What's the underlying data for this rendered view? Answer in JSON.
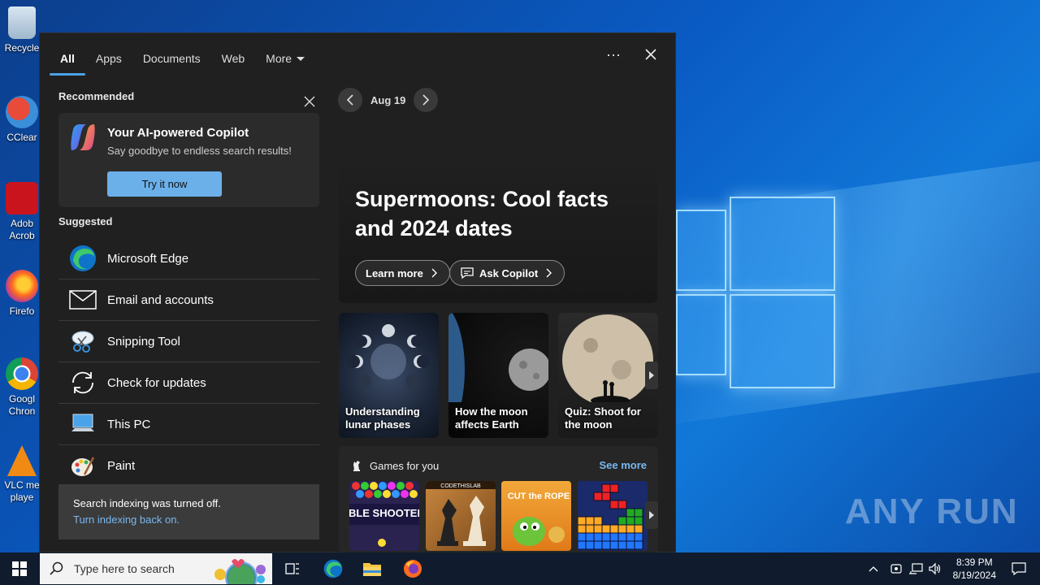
{
  "desktop": {
    "icons": [
      {
        "label": "Recycle"
      },
      {
        "label": "CClear"
      },
      {
        "label": "Adob Acrob"
      },
      {
        "label": "Firefo"
      },
      {
        "label": "Googl Chron"
      },
      {
        "label": "VLC me playe"
      }
    ],
    "watermark": "ANY RUN"
  },
  "search_panel": {
    "tabs": [
      {
        "label": "All"
      },
      {
        "label": "Apps"
      },
      {
        "label": "Documents"
      },
      {
        "label": "Web"
      },
      {
        "label": "More"
      }
    ],
    "recommended": {
      "heading": "Recommended",
      "card_title": "Your AI-powered Copilot",
      "card_subtitle": "Say goodbye to endless search results!",
      "card_button": "Try it now"
    },
    "suggested": {
      "heading": "Suggested",
      "items": [
        {
          "label": "Microsoft Edge",
          "icon": "edge-icon"
        },
        {
          "label": "Email and accounts",
          "icon": "mail-icon"
        },
        {
          "label": "Snipping Tool",
          "icon": "snipping-tool-icon"
        },
        {
          "label": "Check for updates",
          "icon": "sync-icon"
        },
        {
          "label": "This PC",
          "icon": "computer-icon"
        },
        {
          "label": "Paint",
          "icon": "paint-icon"
        }
      ]
    },
    "indexing": {
      "message": "Search indexing was turned off.",
      "link": "Turn indexing back on."
    },
    "date_nav": {
      "date": "Aug 19"
    },
    "hero": {
      "title": "Supermoons: Cool facts and 2024 dates",
      "learn_more": "Learn more",
      "ask_copilot": "Ask Copilot"
    },
    "cards": [
      {
        "label": "Understanding lunar phases"
      },
      {
        "label": "How the moon affects Earth"
      },
      {
        "label": "Quiz: Shoot for the moon"
      }
    ],
    "games": {
      "heading": "Games for you",
      "see_more": "See more",
      "items": [
        {
          "label": "BUBBLE SHOOTER HD"
        },
        {
          "label": "CODETHISLAB"
        },
        {
          "label": "CUT the ROPE"
        },
        {
          "label": ""
        }
      ]
    }
  },
  "taskbar": {
    "search_placeholder": "Type here to search",
    "time": "8:39 PM",
    "date": "8/19/2024"
  }
}
